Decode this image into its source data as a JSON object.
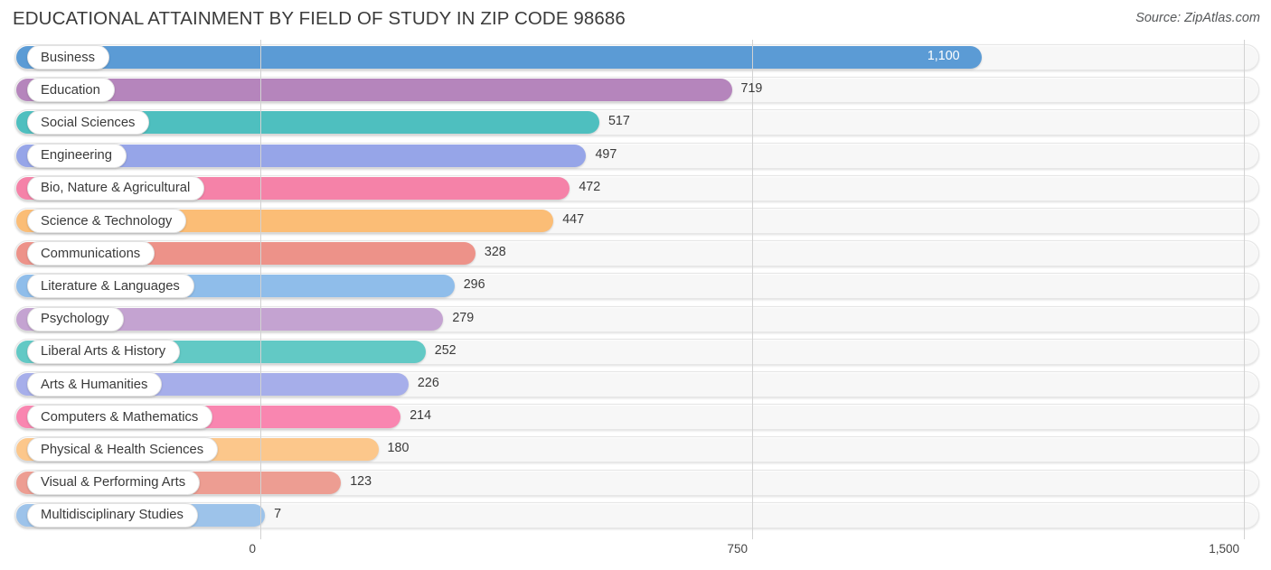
{
  "header": {
    "title": "EDUCATIONAL ATTAINMENT BY FIELD OF STUDY IN ZIP CODE 98686",
    "source": "Source: ZipAtlas.com"
  },
  "chart_data": {
    "type": "bar",
    "orientation": "horizontal",
    "title": "EDUCATIONAL ATTAINMENT BY FIELD OF STUDY IN ZIP CODE 98686",
    "xlabel": "",
    "ylabel": "",
    "xlim": [
      0,
      1500
    ],
    "grid": true,
    "legend": "none",
    "xticks": [
      0,
      750,
      1500
    ],
    "xtick_labels": [
      "0",
      "750",
      "1,500"
    ],
    "categories": [
      "Business",
      "Education",
      "Social Sciences",
      "Engineering",
      "Bio, Nature & Agricultural",
      "Science & Technology",
      "Communications",
      "Literature & Languages",
      "Psychology",
      "Liberal Arts & History",
      "Arts & Humanities",
      "Computers & Mathematics",
      "Physical & Health Sciences",
      "Visual & Performing Arts",
      "Multidisciplinary Studies"
    ],
    "values": [
      1100,
      719,
      517,
      497,
      472,
      447,
      328,
      296,
      279,
      252,
      226,
      214,
      180,
      123,
      7
    ],
    "value_labels": [
      "1,100",
      "719",
      "517",
      "497",
      "472",
      "447",
      "328",
      "296",
      "279",
      "252",
      "226",
      "214",
      "180",
      "123",
      "7"
    ],
    "colors": [
      "#5b9bd5",
      "#b585bc",
      "#4ebfbf",
      "#96a5e8",
      "#f582a8",
      "#fbbd76",
      "#ed9289",
      "#8fbdea",
      "#c4a3d1",
      "#62c9c5",
      "#a6aeea",
      "#f986b0",
      "#fcc78b",
      "#ed9d92",
      "#9dc3ea"
    ]
  },
  "axis": {
    "ticks": [
      {
        "label": "0"
      },
      {
        "label": "750"
      },
      {
        "label": "1,500"
      }
    ]
  }
}
